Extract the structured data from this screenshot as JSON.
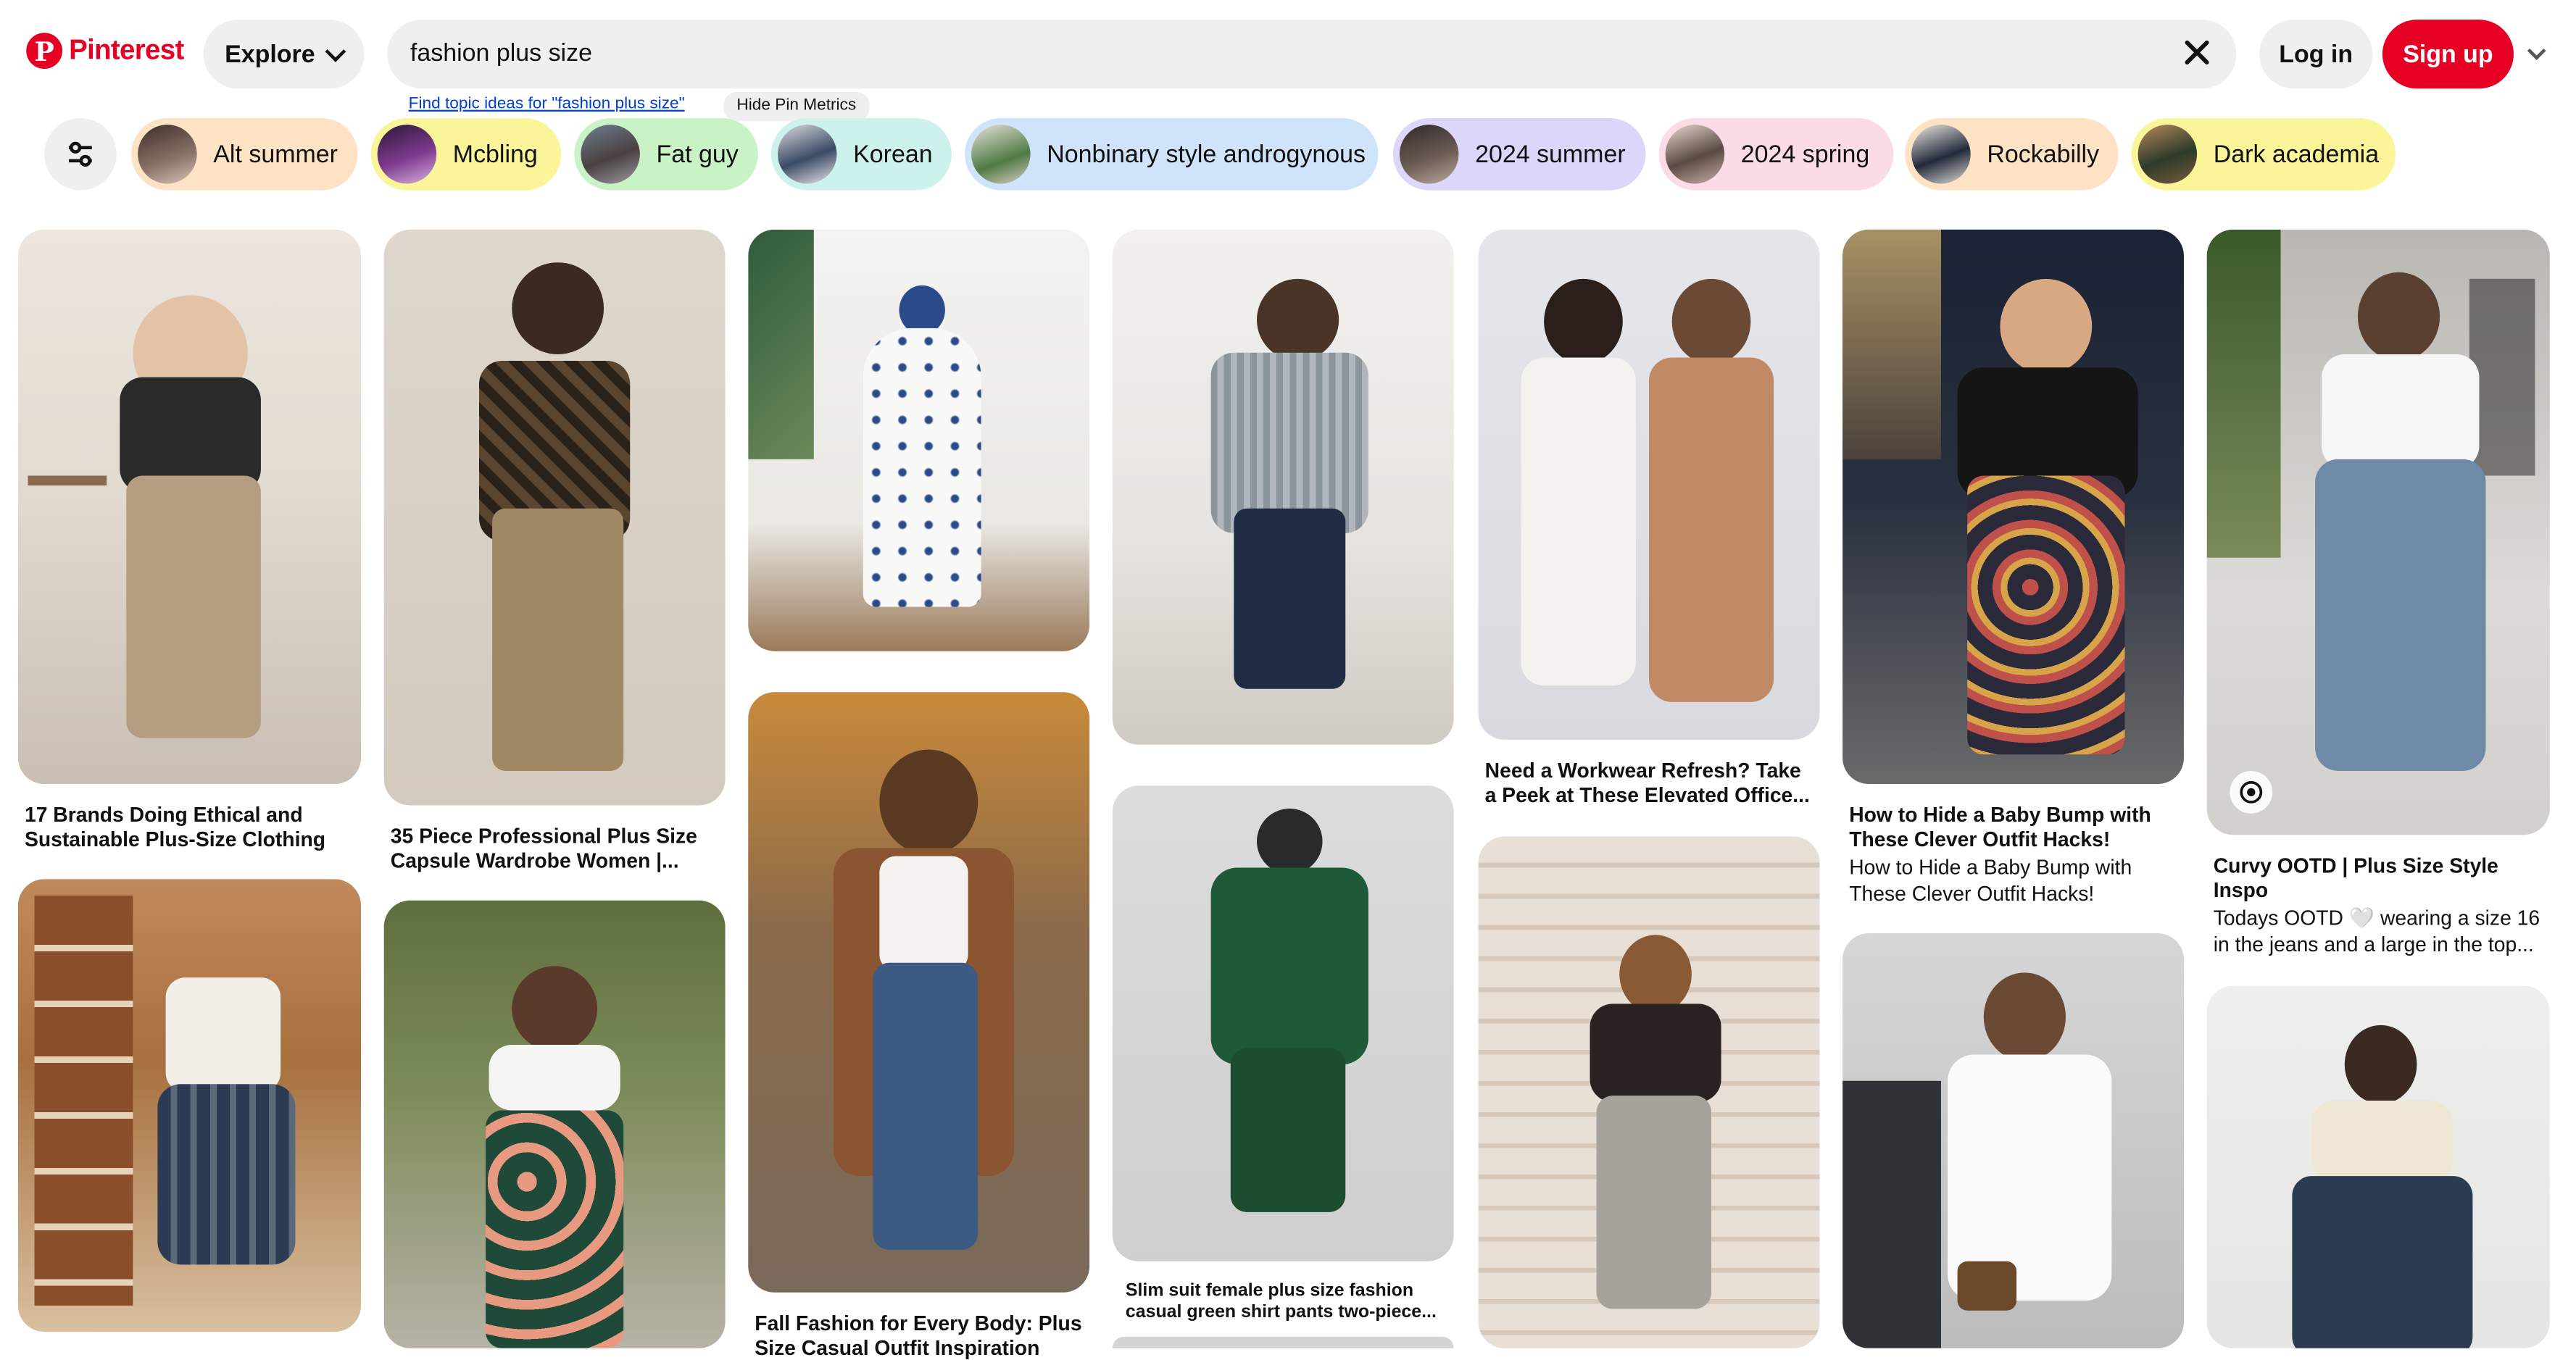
{
  "brand": {
    "name": "Pinterest",
    "color": "#e60023"
  },
  "header": {
    "explore_label": "Explore",
    "search_value": "fashion plus size",
    "login_label": "Log in",
    "signup_label": "Sign up"
  },
  "helper": {
    "topic_link": "Find topic ideas for \"fashion plus size\"",
    "metrics_label": "Hide Pin Metrics"
  },
  "chips": [
    {
      "label": "Alt summer",
      "bg": "#fde2c4"
    },
    {
      "label": "Mcbling",
      "bg": "#fbf59a"
    },
    {
      "label": "Fat guy",
      "bg": "#c9f3c6"
    },
    {
      "label": "Korean",
      "bg": "#cdf2ee"
    },
    {
      "label": "Nonbinary style androgynous",
      "bg": "#cfe4fb"
    },
    {
      "label": "2024 summer",
      "bg": "#dcd6fa"
    },
    {
      "label": "2024 spring",
      "bg": "#fbdbe6"
    },
    {
      "label": "Rockabilly",
      "bg": "#fde2c4"
    },
    {
      "label": "Dark academia",
      "bg": "#fbf59a"
    }
  ],
  "pins": [
    {
      "title": "17 Brands Doing Ethical and Sustainable Plus-Size Clothing"
    },
    {
      "title": "35 Piece Professional Plus Size Capsule Wardrobe Women |..."
    },
    {
      "title": "Fall Fashion for Every Body: Plus Size Casual Outfit Inspiration"
    },
    {
      "title": "Slim suit female plus size fashion casual green shirt pants two-piece..."
    },
    {
      "title": "Need a Workwear Refresh? Take a Peek at These Elevated Office..."
    },
    {
      "title": "How to Hide a Baby Bump with These Clever Outfit Hacks!",
      "description": "How to Hide a Baby Bump with These Clever Outfit Hacks!"
    },
    {
      "title": "Curvy OOTD | Plus Size Style Inspo",
      "description": "Todays OOTD 🤍 wearing a size 16 in the jeans and a large in the top..."
    }
  ]
}
